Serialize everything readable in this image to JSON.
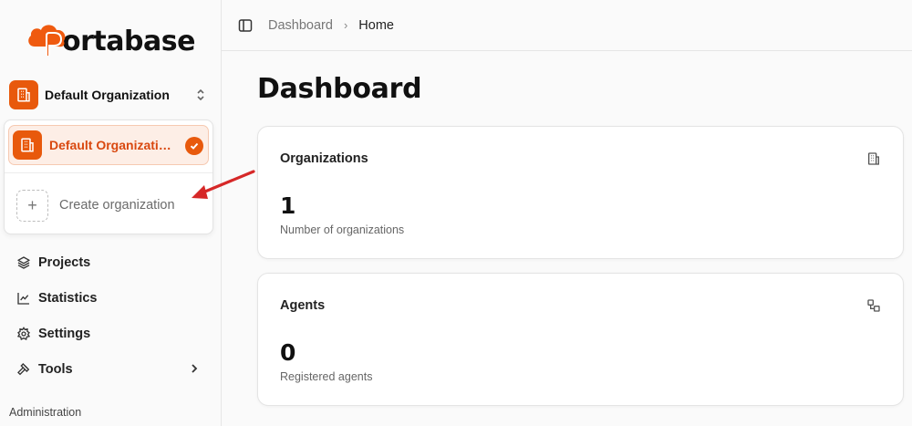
{
  "app": {
    "logo_text": "ortabase"
  },
  "org_switcher": {
    "current": "Default Organization"
  },
  "org_dropdown": {
    "items": [
      {
        "label": "Default Organization",
        "selected": true
      }
    ],
    "create_label": "Create organization"
  },
  "nav": {
    "items": [
      {
        "label": "Projects",
        "icon": "layers-icon"
      },
      {
        "label": "Statistics",
        "icon": "chart-icon"
      },
      {
        "label": "Settings",
        "icon": "gear-icon"
      },
      {
        "label": "Tools",
        "icon": "hammer-icon",
        "has_submenu": true
      }
    ],
    "section_label": "Administration"
  },
  "breadcrumb": {
    "parent": "Dashboard",
    "current": "Home"
  },
  "page": {
    "title": "Dashboard"
  },
  "cards": [
    {
      "title": "Organizations",
      "value": "1",
      "subtitle": "Number of organizations",
      "icon": "building-icon"
    },
    {
      "title": "Agents",
      "value": "0",
      "subtitle": "Registered agents",
      "icon": "network-icon"
    }
  ],
  "colors": {
    "accent": "#e8590c",
    "accent_light": "#fdeee6",
    "annotation_arrow": "#d62828"
  }
}
